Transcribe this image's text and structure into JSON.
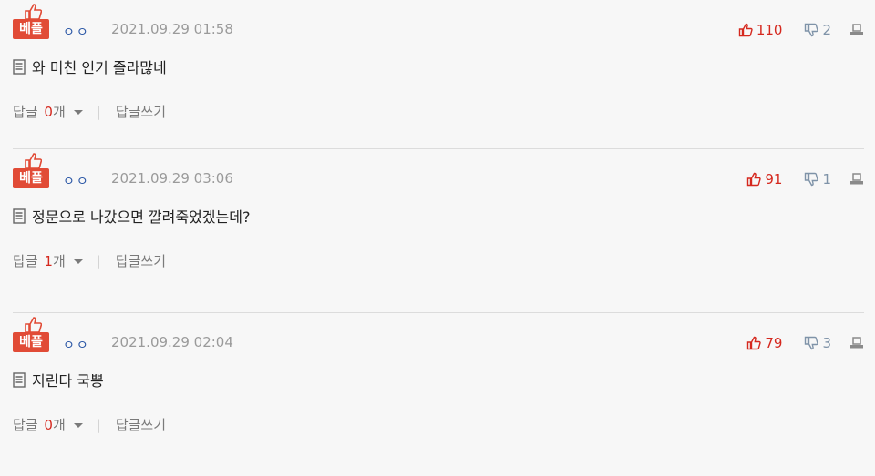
{
  "comments": [
    {
      "badge": "베플",
      "nick": "ㅇㅇ",
      "date": "2021.09.29 01:58",
      "up": "110",
      "down": "2",
      "text": "와 미친 인기 졸라많네",
      "reply_label": "답글",
      "reply_count": "0",
      "reply_unit": "개",
      "write_label": "답글쓰기"
    },
    {
      "badge": "베플",
      "nick": "ㅇㅇ",
      "date": "2021.09.29 03:06",
      "up": "91",
      "down": "1",
      "text": "정문으로 나갔으면 깔려죽었겠는데?",
      "reply_label": "답글",
      "reply_count": "1",
      "reply_unit": "개",
      "write_label": "답글쓰기"
    },
    {
      "badge": "베플",
      "nick": "ㅇㅇ",
      "date": "2021.09.29 02:04",
      "up": "79",
      "down": "3",
      "text": "지린다 국뽕",
      "reply_label": "답글",
      "reply_count": "0",
      "reply_unit": "개",
      "write_label": "답글쓰기"
    }
  ],
  "colors": {
    "badge": "#e14b36",
    "up": "#d5281e",
    "down": "#7f93a8",
    "nick": "#2b57a6"
  },
  "icons": [
    "thumbs-up-icon",
    "thumbs-down-icon",
    "report-icon",
    "document-icon",
    "caret-down-icon"
  ]
}
